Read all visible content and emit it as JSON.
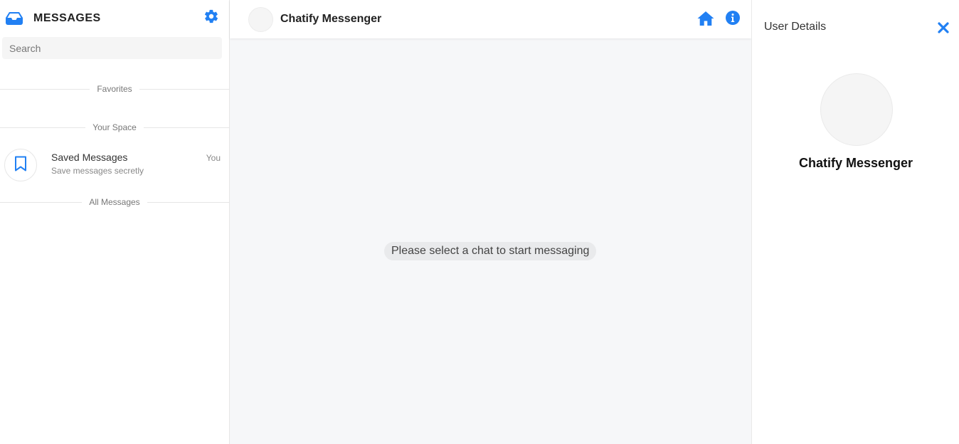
{
  "sidebar": {
    "title": "MESSAGES",
    "search": {
      "placeholder": "Search",
      "value": ""
    },
    "sections": {
      "favorites": "Favorites",
      "your_space": "Your Space",
      "all_messages": "All Messages"
    },
    "saved": {
      "name": "Saved Messages",
      "subtitle": "Save messages secretly",
      "meta": "You"
    }
  },
  "main": {
    "title": "Chatify Messenger",
    "empty_message": "Please select a chat to start messaging"
  },
  "details": {
    "title": "User Details",
    "name": "Chatify Messenger"
  },
  "colors": {
    "accent": "#2180f3",
    "background": "#f6f7f9"
  },
  "icons": [
    "inbox-icon",
    "gear-icon",
    "bookmark-icon",
    "home-icon",
    "info-icon",
    "close-icon"
  ]
}
